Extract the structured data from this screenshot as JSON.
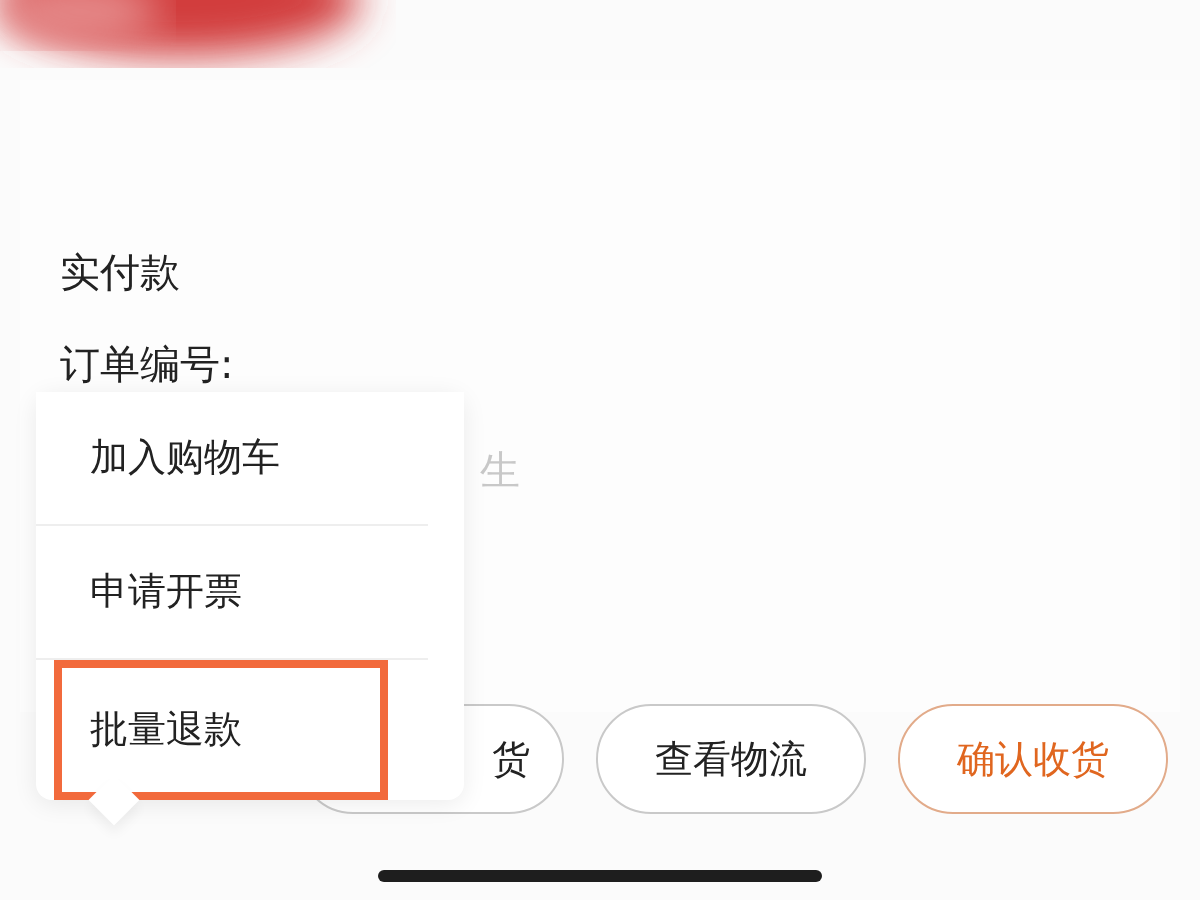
{
  "details": [
    {
      "label": "实付款"
    },
    {
      "label": "订单编号:"
    }
  ],
  "partial_text": "生",
  "actions": [
    {
      "label": "货",
      "primary": false
    },
    {
      "label": "查看物流",
      "primary": false
    },
    {
      "label": "确认收货",
      "primary": true
    }
  ],
  "popup_menu": {
    "items": [
      {
        "label": "加入购物车",
        "highlighted": false
      },
      {
        "label": "申请开票",
        "highlighted": false
      },
      {
        "label": "批量退款",
        "highlighted": true
      }
    ]
  }
}
